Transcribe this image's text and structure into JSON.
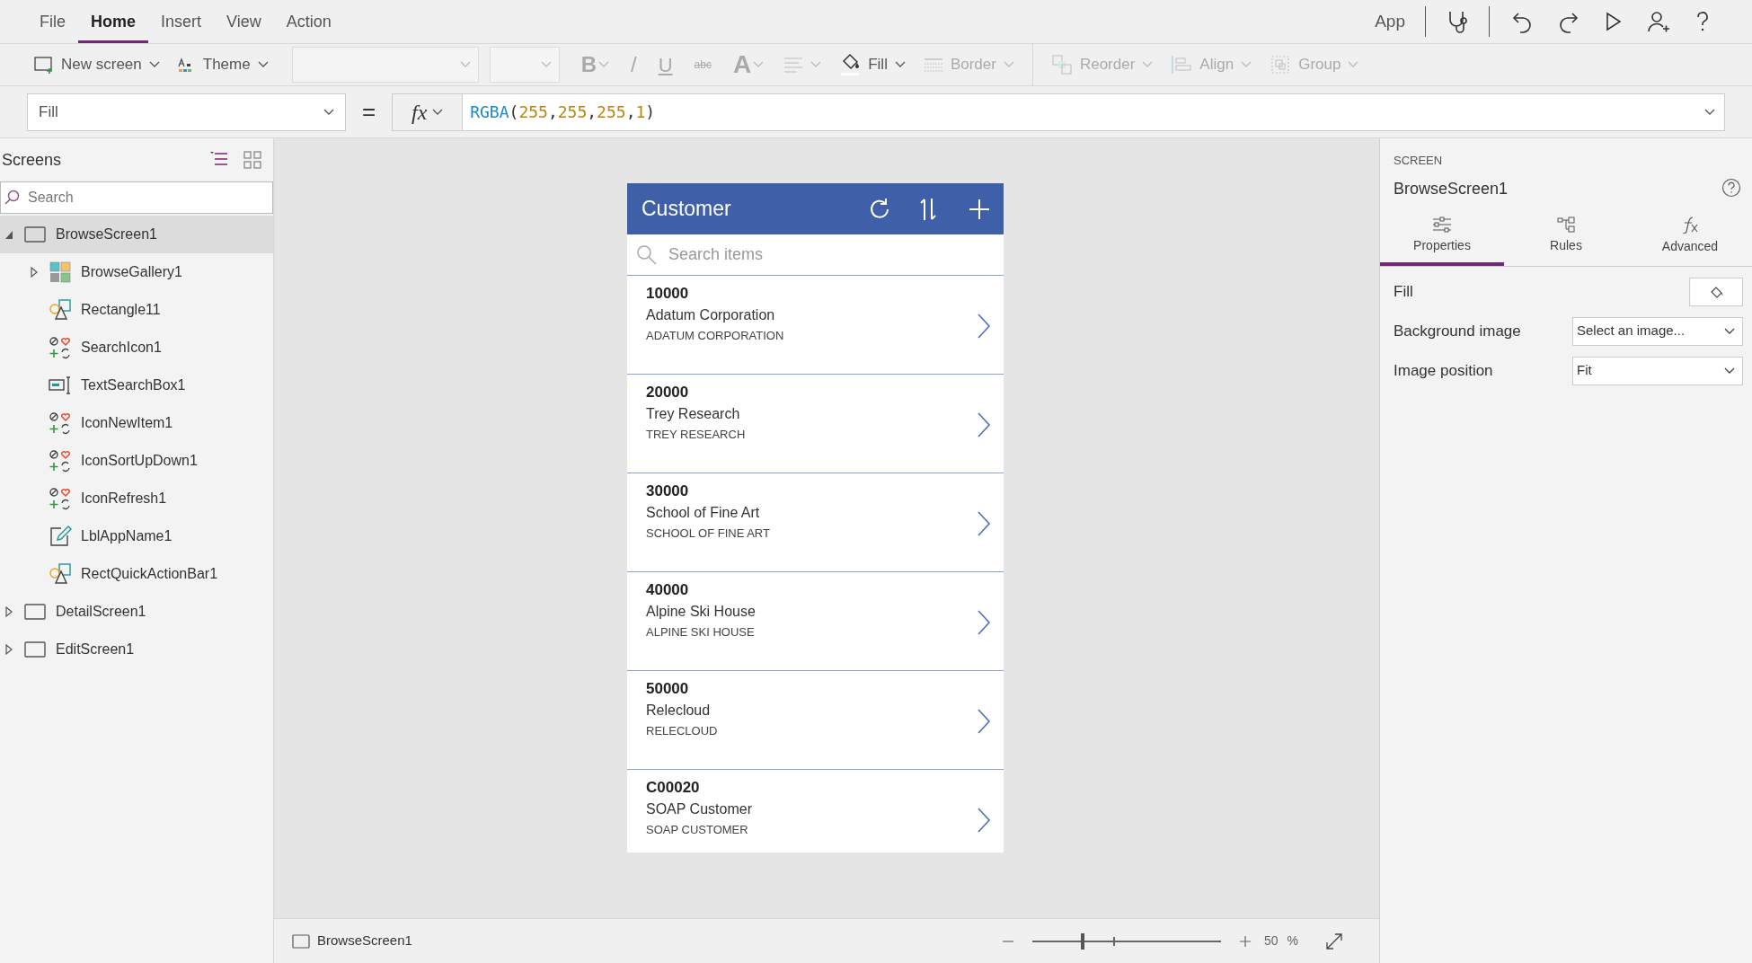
{
  "menu": {
    "tabs": [
      {
        "label": "File",
        "selected": false
      },
      {
        "label": "Home",
        "selected": true
      },
      {
        "label": "Insert",
        "selected": false
      },
      {
        "label": "View",
        "selected": false
      },
      {
        "label": "Action",
        "selected": false
      }
    ],
    "app_label": "App"
  },
  "toolbar": [
    [
      {
        "kind": "new-screen",
        "label": "New screen",
        "disabled": false
      },
      {
        "kind": "theme",
        "label": "Theme",
        "disabled": false
      },
      {
        "kind": "font-select",
        "disabled": true
      },
      {
        "kind": "size-select",
        "disabled": true
      },
      {
        "kind": "bold",
        "label": "B",
        "disabled": true
      },
      {
        "kind": "italic",
        "label": "/",
        "disabled": true
      },
      {
        "kind": "underline",
        "label": "U",
        "disabled": true
      },
      {
        "kind": "strike",
        "label": "abc",
        "disabled": true
      },
      {
        "kind": "font-color",
        "label": "A",
        "disabled": true
      },
      {
        "kind": "text-align",
        "disabled": true
      },
      {
        "kind": "fill",
        "label": "Fill",
        "disabled": false
      },
      {
        "kind": "border",
        "label": "Border",
        "disabled": true
      }
    ],
    [
      {
        "kind": "reorder",
        "label": "Reorder",
        "disabled": true
      },
      {
        "kind": "align",
        "label": "Align",
        "disabled": true
      },
      {
        "kind": "group",
        "label": "Group",
        "disabled": true
      }
    ]
  ],
  "formula": {
    "property": "Fill",
    "equals": "=",
    "fx": "fx",
    "tokens": [
      {
        "kind": "function",
        "text": "RGBA"
      },
      {
        "kind": "punct",
        "text": "("
      },
      {
        "kind": "number",
        "text": "255"
      },
      {
        "kind": "punct",
        "text": ","
      },
      {
        "kind": "number",
        "text": "255"
      },
      {
        "kind": "punct",
        "text": ","
      },
      {
        "kind": "number",
        "text": "255"
      },
      {
        "kind": "punct",
        "text": ","
      },
      {
        "kind": "number",
        "text": "1"
      },
      {
        "kind": "punct",
        "text": ")"
      }
    ]
  },
  "screens_panel": {
    "title": "Screens",
    "view_modes": [
      {
        "kind": "tree",
        "selected": true
      },
      {
        "kind": "grid",
        "selected": false
      }
    ],
    "search_placeholder": "Search",
    "tree": [
      {
        "label": "BrowseScreen1",
        "kind": "screen",
        "selected": true,
        "expanded": true,
        "children": [
          {
            "label": "BrowseGallery1",
            "kind": "gallery",
            "selected": false,
            "expanded": false
          },
          {
            "label": "Rectangle11",
            "kind": "shape",
            "selected": false
          },
          {
            "label": "SearchIcon1",
            "kind": "icon",
            "selected": false
          },
          {
            "label": "TextSearchBox1",
            "kind": "text-input",
            "selected": false
          },
          {
            "label": "IconNewItem1",
            "kind": "icon",
            "selected": false
          },
          {
            "label": "IconSortUpDown1",
            "kind": "icon",
            "selected": false
          },
          {
            "label": "IconRefresh1",
            "kind": "icon",
            "selected": false
          },
          {
            "label": "LblAppName1",
            "kind": "label",
            "selected": false
          },
          {
            "label": "RectQuickActionBar1",
            "kind": "shape",
            "selected": false
          }
        ]
      },
      {
        "label": "DetailScreen1",
        "kind": "screen",
        "selected": false,
        "expanded": false
      },
      {
        "label": "EditScreen1",
        "kind": "screen",
        "selected": false,
        "expanded": false
      }
    ]
  },
  "app_screen": {
    "title": "Customer",
    "search_placeholder": "Search items",
    "rows": [
      {
        "id": "10000",
        "name": "Adatum Corporation",
        "name_upper": "ADATUM CORPORATION"
      },
      {
        "id": "20000",
        "name": "Trey Research",
        "name_upper": "TREY RESEARCH"
      },
      {
        "id": "30000",
        "name": "School of Fine Art",
        "name_upper": "SCHOOL OF FINE ART"
      },
      {
        "id": "40000",
        "name": "Alpine Ski House",
        "name_upper": "ALPINE SKI HOUSE"
      },
      {
        "id": "50000",
        "name": "Relecloud",
        "name_upper": "RELECLOUD"
      },
      {
        "id": "C00020",
        "name": "SOAP Customer",
        "name_upper": "SOAP CUSTOMER"
      }
    ]
  },
  "properties_panel": {
    "section": "SCREEN",
    "name": "BrowseScreen1",
    "tabs": [
      {
        "label": "Properties",
        "kind": "properties",
        "selected": true
      },
      {
        "label": "Rules",
        "kind": "rules",
        "selected": false
      },
      {
        "label": "Advanced",
        "kind": "advanced",
        "selected": false
      }
    ],
    "properties": [
      {
        "kind": "color",
        "label": "Fill"
      },
      {
        "kind": "dropdown",
        "label": "Background image",
        "value": "Select an image..."
      },
      {
        "kind": "dropdown",
        "label": "Image position",
        "value": "Fit"
      }
    ]
  },
  "status_bar": {
    "screen": "BrowseScreen1",
    "zoom": {
      "level": 0.26,
      "value": "50",
      "unit": "%"
    }
  }
}
